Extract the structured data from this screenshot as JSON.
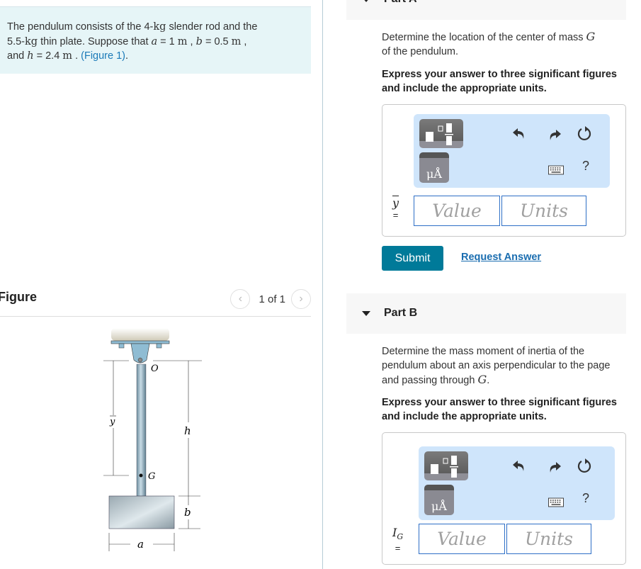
{
  "problem": {
    "line1_pre": "The pendulum consists of the 4-",
    "unit_kg": "kg",
    "line1_post": " slender rod and the",
    "line2_pre": "5.5-",
    "line2_mid": " thin plate. Suppose that ",
    "var_a": "a",
    "eq_a": " = 1 ",
    "unit_m": "m",
    "sep1": " , ",
    "var_b": "b",
    "eq_b": " = 0.5 ",
    "sep2": " ,",
    "line3_pre": "and ",
    "var_h": "h",
    "eq_h": " = 2.4 ",
    "sep3": " . ",
    "figure_link": "(Figure 1)",
    "end": "."
  },
  "figure_panel": {
    "title": "Figure",
    "pager_text": "1 of 1",
    "prev_icon": "chevron-left-icon",
    "next_icon": "chevron-right-icon",
    "labels": {
      "O": "O",
      "G": "G",
      "ybar": "y",
      "h": "h",
      "b": "b",
      "a": "a"
    }
  },
  "parts": [
    {
      "title": "Part A",
      "question_pre": "Determine the location of the center of mass ",
      "question_var": "G",
      "question_post": "of the pendulum.",
      "instructions": "Express your answer to three significant figures and include the appropriate units.",
      "variable_label": "y",
      "equals": "=",
      "value_placeholder": "Value",
      "units_placeholder": "Units",
      "submit_label": "Submit",
      "request_label": "Request Answer"
    },
    {
      "title": "Part B",
      "question_pre": "Determine the mass moment of inertia of the pendulum about an axis perpendicular to the page and passing through ",
      "question_var": "G",
      "question_post": ".",
      "instructions": "Express your answer to three significant figures and include the appropriate units.",
      "variable_label": "I",
      "variable_sub": "G",
      "equals": "=",
      "value_placeholder": "Value",
      "units_placeholder": "Units"
    }
  ],
  "toolbar": {
    "templates_icon": "templates-icon",
    "units_button_label": "μÅ",
    "undo_icon": "undo-icon",
    "redo_icon": "redo-icon",
    "reset_icon": "reset-icon",
    "keyboard_icon": "keyboard-icon",
    "help_label": "?"
  },
  "colors": {
    "problem_bg": "#e6f5f7",
    "link": "#1a7ab8",
    "submit_bg": "#007a99",
    "toolbar_bg": "#cfe5fb",
    "input_border": "#2e6fc6"
  }
}
